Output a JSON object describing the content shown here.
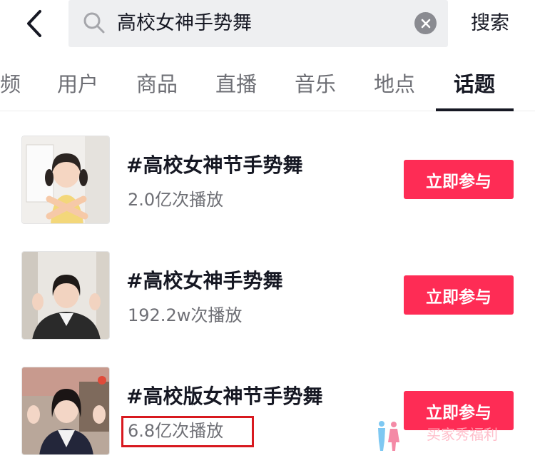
{
  "search": {
    "query": "高校女神手势舞",
    "action_label": "搜索"
  },
  "tabs": [
    {
      "label": "频"
    },
    {
      "label": "用户"
    },
    {
      "label": "商品"
    },
    {
      "label": "直播"
    },
    {
      "label": "音乐"
    },
    {
      "label": "地点"
    },
    {
      "label": "话题",
      "active": true
    }
  ],
  "topics": [
    {
      "title": "#高校女神节手势舞",
      "plays": "2.0亿次播放",
      "button": "立即参与"
    },
    {
      "title": "#高校女神手势舞",
      "plays": "192.2w次播放",
      "button": "立即参与"
    },
    {
      "title": "#高校版女神节手势舞",
      "plays": "6.8亿次播放",
      "button": "立即参与"
    }
  ],
  "watermark": {
    "text": "买家秀福利"
  },
  "colors": {
    "accent": "#fe2c55",
    "highlight": "#d8191f",
    "search_bg": "#eeeff1",
    "text_primary": "#161823",
    "text_secondary": "#6e6f75"
  },
  "icons": {
    "back": "chevron-left-icon",
    "search": "search-icon",
    "clear": "clear-icon"
  }
}
